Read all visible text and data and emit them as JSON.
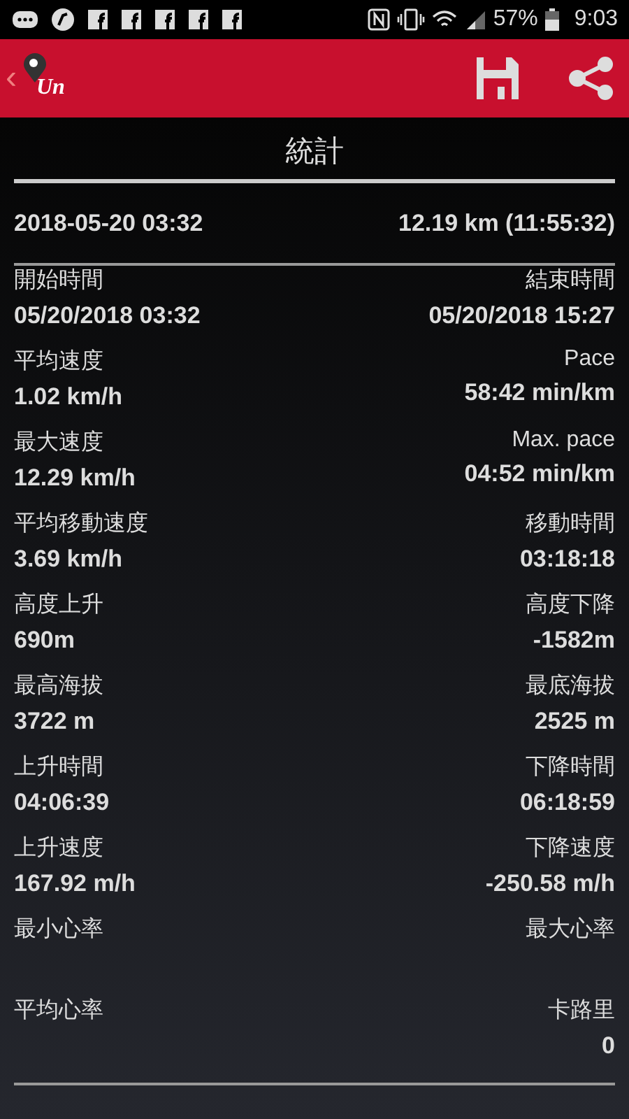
{
  "status_bar": {
    "battery": "57%",
    "time": "9:03"
  },
  "app_bar": {
    "back": "‹",
    "logo_text": "Un"
  },
  "title": "統計",
  "summary": {
    "start": "2018-05-20 03:32",
    "distance": "12.19 km (11:55:32)"
  },
  "stats": [
    {
      "left_label": "開始時間",
      "left_value": "05/20/2018 03:32",
      "right_label": "結束時間",
      "right_value": "05/20/2018 15:27"
    },
    {
      "left_label": "平均速度",
      "left_value": "1.02 km/h",
      "right_label": "Pace",
      "right_value": "58:42 min/km"
    },
    {
      "left_label": "最大速度",
      "left_value": "12.29 km/h",
      "right_label": "Max. pace",
      "right_value": "04:52 min/km"
    },
    {
      "left_label": "平均移動速度",
      "left_value": "3.69 km/h",
      "right_label": "移動時間",
      "right_value": "03:18:18"
    },
    {
      "left_label": "高度上升",
      "left_value": "690m",
      "right_label": "高度下降",
      "right_value": "-1582m"
    },
    {
      "left_label": "最高海拔",
      "left_value": "3722 m",
      "right_label": "最底海拔",
      "right_value": "2525 m"
    },
    {
      "left_label": "上升時間",
      "left_value": "04:06:39",
      "right_label": "下降時間",
      "right_value": "06:18:59"
    },
    {
      "left_label": "上升速度",
      "left_value": "167.92 m/h",
      "right_label": "下降速度",
      "right_value": "-250.58 m/h"
    },
    {
      "left_label": "最小心率",
      "right_label": "最大心率"
    },
    {
      "left_label": "平均心率",
      "right_label": "卡路里",
      "right_value": "0"
    }
  ]
}
